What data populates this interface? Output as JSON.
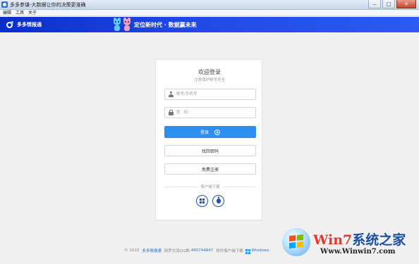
{
  "window": {
    "title": "多多参谋-大数据让你的决策更准确",
    "controls": [
      "minimize",
      "maximize",
      "close"
    ]
  },
  "menu": {
    "items": [
      "编辑",
      "工具",
      "关于"
    ]
  },
  "header": {
    "brand": "多多情报通",
    "slogan": "定位新时代 · 数据赢未来",
    "colors": {
      "start": "#0b2dc9",
      "end": "#2c5af2"
    }
  },
  "login": {
    "title": "欢迎登录",
    "subtitle": "注意保护账号安全",
    "username_placeholder": "账号/手机号",
    "password_placeholder": "密　码",
    "login_label": "登录",
    "recover_label": "找回密码",
    "register_label": "免费注册",
    "client_download_label": "客户端下载",
    "accent_color": "#2e8ff0"
  },
  "footer": {
    "copyright": "© 2018",
    "brand_link": "多多情报通",
    "qq_group_label": "网罗交流QQ群:",
    "qq_group_number": "465744847",
    "download_label": "软件客户端下载",
    "windows_label": "Windows"
  },
  "watermark": {
    "brand_w7": "Win7",
    "brand_rest": "系统之家",
    "url": "Www.Winwin7.com"
  }
}
